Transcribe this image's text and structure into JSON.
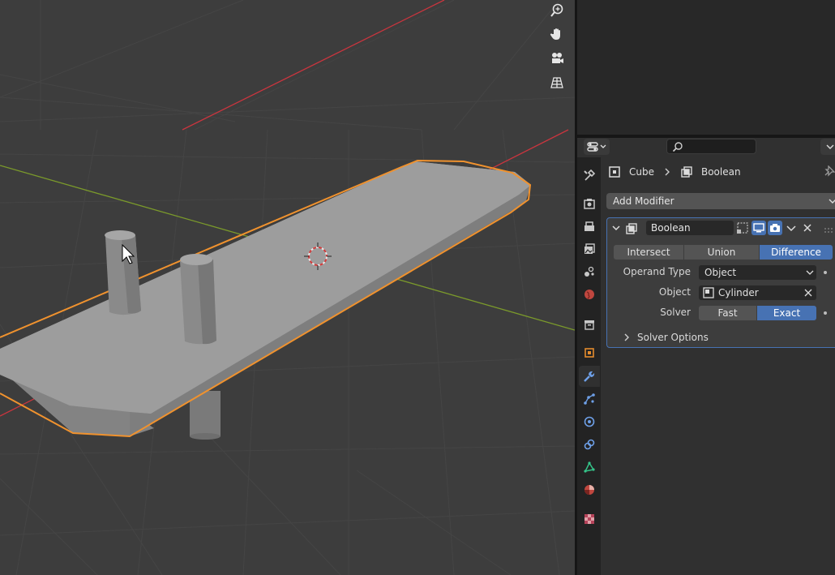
{
  "viewport": {
    "nav_icons": [
      "zoom-icon",
      "hand-pan-icon",
      "camera-icon",
      "grid-perspective-icon"
    ],
    "colors": {
      "selection_outline": "#f0922e",
      "x_axis": "#c9353e",
      "y_axis": "#7b9a2b",
      "background": "#3d3d3d"
    }
  },
  "properties": {
    "header": {
      "search_placeholder": ""
    },
    "tabs": [
      "tool",
      "render",
      "output",
      "view-layer",
      "scene",
      "world",
      "collection",
      "object",
      "modifiers",
      "particles",
      "physics",
      "constraints",
      "data",
      "material",
      "texture"
    ],
    "active_tab": "modifiers",
    "breadcrumb": {
      "object": "Cube",
      "modifier": "Boolean"
    },
    "add_modifier_label": "Add Modifier",
    "modifier": {
      "name": "Boolean",
      "operations": [
        "Intersect",
        "Union",
        "Difference"
      ],
      "active_operation": "Difference",
      "operand_type_label": "Operand Type",
      "operand_type_value": "Object",
      "object_label": "Object",
      "object_value": "Cylinder",
      "solver_label": "Solver",
      "solvers": [
        "Fast",
        "Exact"
      ],
      "active_solver": "Exact",
      "solver_options_label": "Solver Options"
    }
  }
}
